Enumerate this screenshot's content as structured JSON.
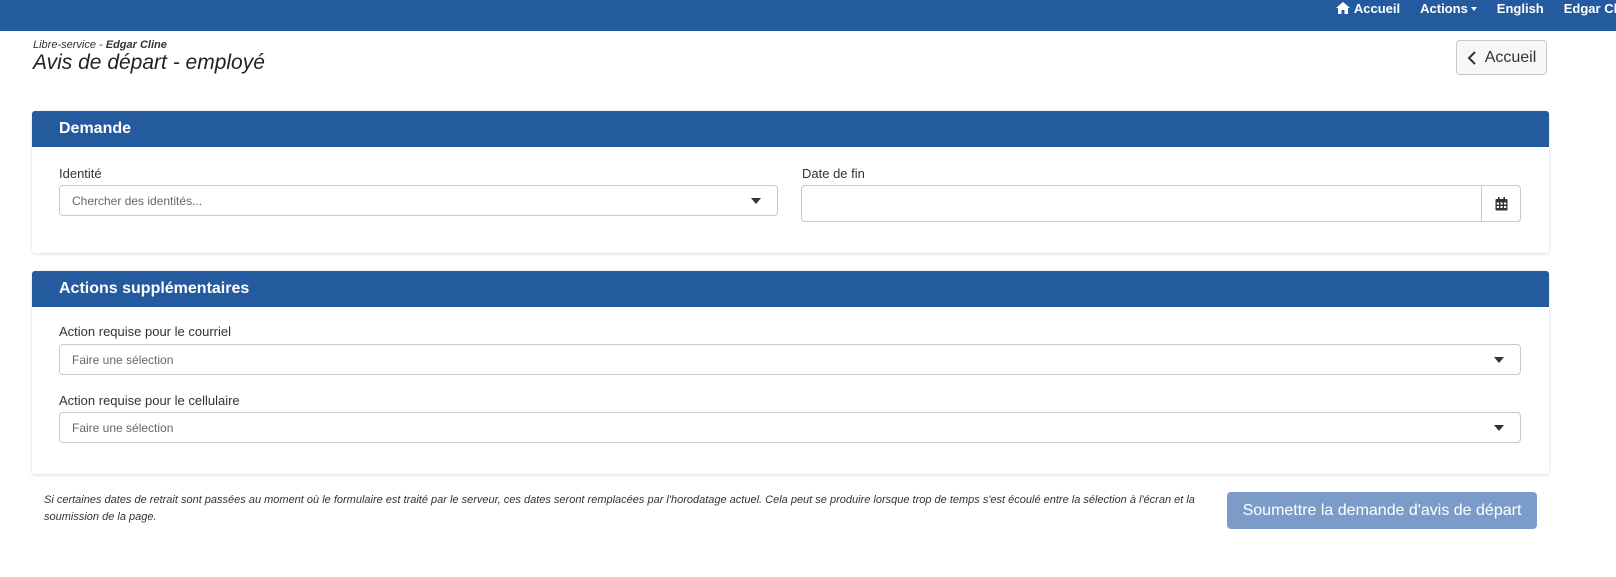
{
  "topnav": {
    "home_label": "Accueil",
    "actions_label": "Actions",
    "language_label": "English",
    "user_label": "Edgar Cline"
  },
  "header": {
    "breadcrumb_prefix": "Libre-service - ",
    "breadcrumb_user": "Edgar Cline",
    "title": "Avis de départ - employé",
    "home_button_label": "Accueil"
  },
  "request_panel": {
    "title": "Demande",
    "identity_label": "Identité",
    "identity_placeholder": "Chercher des identités...",
    "end_date_label": "Date de fin",
    "end_date_value": ""
  },
  "actions_panel": {
    "title": "Actions supplémentaires",
    "email_label": "Action requise pour le courriel",
    "email_placeholder": "Faire une sélection",
    "mobile_label": "Action requise pour le cellulaire",
    "mobile_placeholder": "Faire une sélection"
  },
  "footer": {
    "note": "Si certaines dates de retrait sont passées au moment où le formulaire est traité par le serveur, ces dates seront remplacées par l'horodatage actuel. Cela peut se produire lorsque trop de temps s'est écoulé entre la sélection à l'écran et la soumission de la page.",
    "submit_label": "Soumettre la demande d'avis de départ"
  },
  "colors": {
    "brand": "#245b9e",
    "submit_disabled": "#7b9cc8"
  }
}
